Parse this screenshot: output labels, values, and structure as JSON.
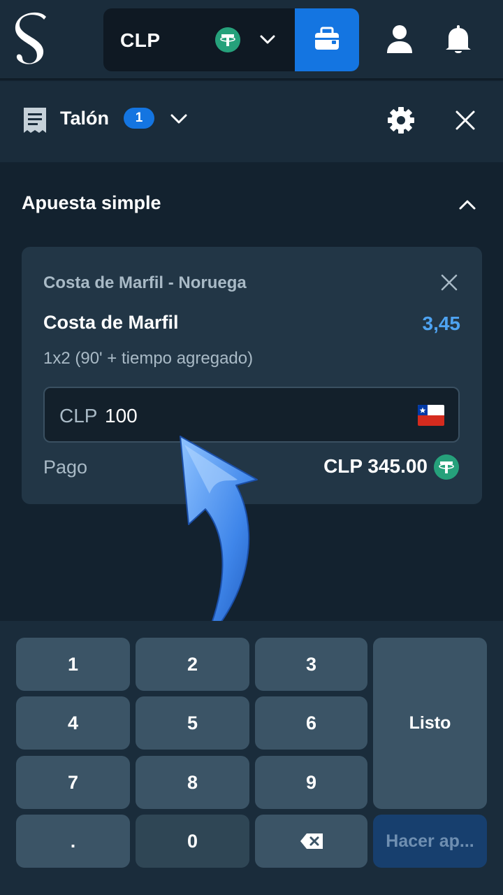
{
  "header": {
    "currency": "CLP",
    "icons": [
      "logo-s",
      "tether-icon",
      "chevron-down-icon",
      "wallet-icon",
      "user-icon",
      "bell-icon"
    ]
  },
  "betslip": {
    "title": "Talón",
    "count": "1",
    "section_title": "Apuesta simple"
  },
  "bet": {
    "match": "Costa de Marfil - Noruega",
    "selection": "Costa de Marfil",
    "odds": "3,45",
    "market": "1x2 (90' + tiempo agregado)",
    "stake_currency": "CLP",
    "stake_value": "100",
    "payout_label": "Pago",
    "payout_value": "CLP 345.00"
  },
  "keypad": {
    "keys": [
      "1",
      "2",
      "3",
      "4",
      "5",
      "6",
      "7",
      "8",
      "9",
      ".",
      "0"
    ],
    "done_label": "Listo",
    "place_bet_label": "Hacer ap..."
  },
  "colors": {
    "background": "#13222f",
    "panel": "#1a2c3b",
    "card": "#223646",
    "accent": "#1475e1",
    "odds": "#4ea3f1",
    "tether": "#26a17b",
    "key": "#3b5466"
  }
}
